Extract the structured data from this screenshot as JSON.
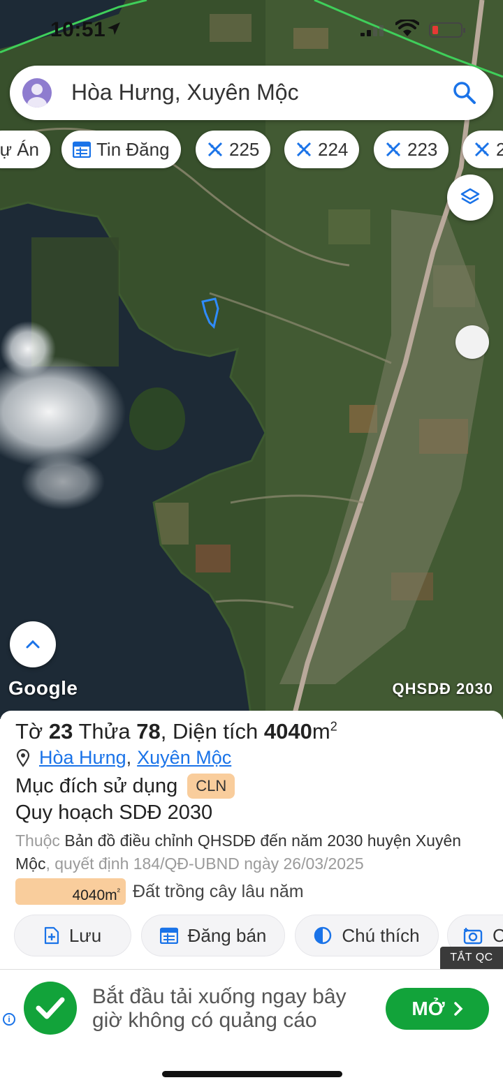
{
  "status": {
    "time": "10:51"
  },
  "search": {
    "query": "Hòa Hưng, Xuyên Mộc"
  },
  "chips": [
    {
      "label": "ự Án",
      "icon": "none"
    },
    {
      "label": "Tin Đăng",
      "icon": "calendar-icon"
    },
    {
      "label": "225",
      "icon": "map-tool-icon"
    },
    {
      "label": "224",
      "icon": "map-tool-icon"
    },
    {
      "label": "223",
      "icon": "map-tool-icon"
    },
    {
      "label": "2",
      "icon": "map-tool-icon"
    }
  ],
  "map": {
    "attribution": "Google",
    "overlay_name": "QHSDĐ 2030"
  },
  "parcel": {
    "to_label": "Tờ",
    "to_value": "23",
    "thua_label": "Thửa",
    "thua_value": "78",
    "area_label": ", Diện tích",
    "area_value": "4040",
    "area_unit": "m",
    "area_unit_sup": "2",
    "ward": "Hòa Hưng",
    "district": "Xuyên Mộc",
    "purpose_label": "Mục đích sử dụng",
    "purpose_code": "CLN",
    "plan_title": "Quy hoạch SDĐ 2030",
    "desc_prefix": "Thuộc",
    "desc_map": "Bản đồ điều chỉnh QHSDĐ đến năm 2030 huyện Xuyên Mộc",
    "desc_suffix": ", quyết định 184/QĐ-UBND ngày 26/03/2025",
    "landuse_area": "4040m",
    "landuse_area_sup": "²",
    "landuse_label": "Đất trồng cây lâu năm",
    "highlight_color": "#f9cd9c"
  },
  "actions": [
    {
      "label": "Lưu",
      "icon": "save-doc-icon"
    },
    {
      "label": "Đăng bán",
      "icon": "calendar-icon"
    },
    {
      "label": "Chú thích",
      "icon": "legend-icon"
    },
    {
      "label": "C",
      "icon": "camera-icon"
    }
  ],
  "ad": {
    "close_label": "TẮT QC",
    "text": "Bắt đầu tải xuống ngay bây giờ không có quảng cáo",
    "cta": "MỞ",
    "accent": "#12a33a"
  }
}
